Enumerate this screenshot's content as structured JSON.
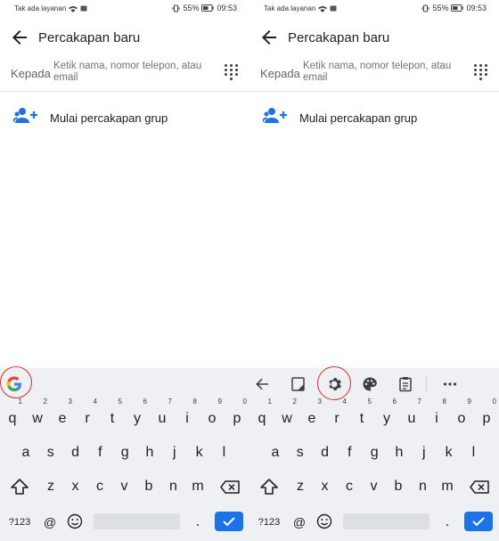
{
  "status_bar": {
    "carrier": "Tak ada layanan",
    "battery": "55%",
    "time": "09:53"
  },
  "app_bar": {
    "title": "Percakapan baru"
  },
  "recipient": {
    "label": "Kepada",
    "placeholder": "Ketik nama, nomor telepon, atau email"
  },
  "group": {
    "label": "Mulai percakapan grup"
  },
  "keyboard": {
    "row1": [
      {
        "k": "q",
        "h": "1"
      },
      {
        "k": "w",
        "h": "2"
      },
      {
        "k": "e",
        "h": "3"
      },
      {
        "k": "r",
        "h": "4"
      },
      {
        "k": "t",
        "h": "5"
      },
      {
        "k": "y",
        "h": "6"
      },
      {
        "k": "u",
        "h": "7"
      },
      {
        "k": "i",
        "h": "8"
      },
      {
        "k": "o",
        "h": "9"
      },
      {
        "k": "p",
        "h": "0"
      }
    ],
    "row2": [
      "a",
      "s",
      "d",
      "f",
      "g",
      "h",
      "j",
      "k",
      "l"
    ],
    "row3": [
      "z",
      "x",
      "c",
      "v",
      "b",
      "n",
      "m"
    ],
    "symbols_label": "?123",
    "at_label": "@",
    "period_label": "."
  },
  "icons": {
    "back": "back-arrow-icon",
    "dialpad": "dialpad-icon",
    "group_add": "group-add-icon",
    "google": "google-g-icon",
    "settings": "gear-icon",
    "theme": "palette-icon",
    "clipboard": "clipboard-icon",
    "more": "more-horiz-icon"
  },
  "colors": {
    "accent": "#1a73e8",
    "highlight_circle": "#d93025",
    "keyboard_bg": "#eef0f3"
  }
}
